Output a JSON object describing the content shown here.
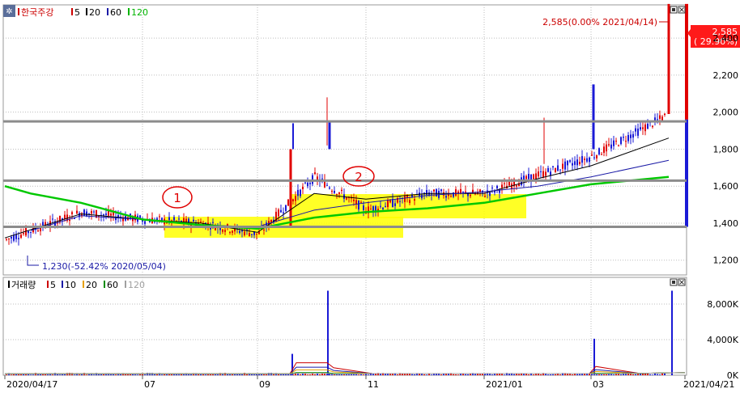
{
  "price_panel": {
    "legend": [
      {
        "label": "한국주강",
        "color": "#cc0000"
      },
      {
        "label": "5",
        "color": "#cc0000"
      },
      {
        "label": "20",
        "color": "#000000"
      },
      {
        "label": "60",
        "color": "#1a1aa6"
      },
      {
        "label": "120",
        "color": "#00b400"
      }
    ],
    "high_annotation": "2,585(0.00% 2021/04/14)",
    "low_annotation": "1,230(-52.42% 2020/05/04)",
    "last_price_box": {
      "value": "2,585",
      "change": "( 29.90%)",
      "color": "#ff1a1a"
    },
    "y_ticks": [
      "2,400",
      "2,200",
      "2,000",
      "1,800",
      "1,600",
      "1,400",
      "1,200"
    ],
    "circle_labels": [
      "1",
      "2"
    ]
  },
  "volume_panel": {
    "legend": [
      {
        "label": "거래량",
        "color": "#000000"
      },
      {
        "label": "5",
        "color": "#cc0000"
      },
      {
        "label": "10",
        "color": "#1a1aa6"
      },
      {
        "label": "20",
        "color": "#e6a000"
      },
      {
        "label": "60",
        "color": "#008c00"
      },
      {
        "label": "120",
        "color": "#a0a0a0"
      }
    ],
    "y_ticks": [
      "8,000K",
      "4,000K",
      "0K"
    ]
  },
  "x_axis": {
    "labels": [
      "2020/04/17",
      "07",
      "09",
      "11",
      "2021/01",
      "03",
      "2021/04/21"
    ]
  },
  "chart_data": [
    {
      "type": "candlestick",
      "title": "한국주강",
      "x_range": [
        "2020/04/17",
        "2021/04/21"
      ],
      "ylim": [
        1120,
        2580
      ],
      "support_lines": [
        1950,
        1630,
        1380
      ],
      "series": [
        {
          "name": "5",
          "x": [
            "2020/04",
            "2020/06",
            "2020/07",
            "2020/08",
            "2020/09",
            "2020/10",
            "2020/11",
            "2020/12",
            "2021/01",
            "2021/02",
            "2021/03",
            "2021/04/14"
          ],
          "values": [
            1310,
            1460,
            1420,
            1400,
            1340,
            1650,
            1470,
            1560,
            1560,
            1660,
            1760,
            1990
          ]
        },
        {
          "name": "20",
          "x": [
            "2020/04",
            "2020/06",
            "2020/07",
            "2020/08",
            "2020/09",
            "2020/10",
            "2020/11",
            "2020/12",
            "2021/01",
            "2021/02",
            "2021/03",
            "2021/04/14"
          ],
          "values": [
            1320,
            1450,
            1420,
            1400,
            1350,
            1560,
            1530,
            1560,
            1560,
            1640,
            1710,
            1860
          ]
        },
        {
          "name": "60",
          "x": [
            "2020/05",
            "2020/06",
            "2020/07",
            "2020/08",
            "2020/09",
            "2020/10",
            "2020/11",
            "2020/12",
            "2021/01",
            "2021/02",
            "2021/03",
            "2021/04/14"
          ],
          "values": [
            1360,
            1440,
            1420,
            1390,
            1380,
            1470,
            1510,
            1550,
            1570,
            1600,
            1650,
            1740
          ]
        },
        {
          "name": "120",
          "x": [
            "2020/04/17",
            "2020/05",
            "2020/06",
            "2020/07",
            "2020/08",
            "2020/09",
            "2020/10",
            "2020/11",
            "2020/12",
            "2021/01",
            "2021/02",
            "2021/03",
            "2021/04/14"
          ],
          "values": [
            1600,
            1560,
            1510,
            1420,
            1390,
            1370,
            1430,
            1460,
            1480,
            1510,
            1560,
            1610,
            1650
          ]
        }
      ],
      "annotations": [
        {
          "text": "2,585(0.00% 2021/04/14)",
          "x": "2021/04/14",
          "y": 2585
        },
        {
          "text": "1,230(-52.42% 2020/05/04)",
          "x": "2020/05/04",
          "y": 1230
        }
      ]
    },
    {
      "type": "bar",
      "title": "거래량",
      "x_range": [
        "2020/04/17",
        "2021/04/21"
      ],
      "ylim": [
        0,
        11000
      ],
      "spikes": [
        {
          "x": "2020/09",
          "value": 2400
        },
        {
          "x": "2020/10",
          "value": 9500
        },
        {
          "x": "2021/03",
          "value": 4100
        },
        {
          "x": "2021/04/14",
          "value": 9500
        }
      ]
    }
  ]
}
